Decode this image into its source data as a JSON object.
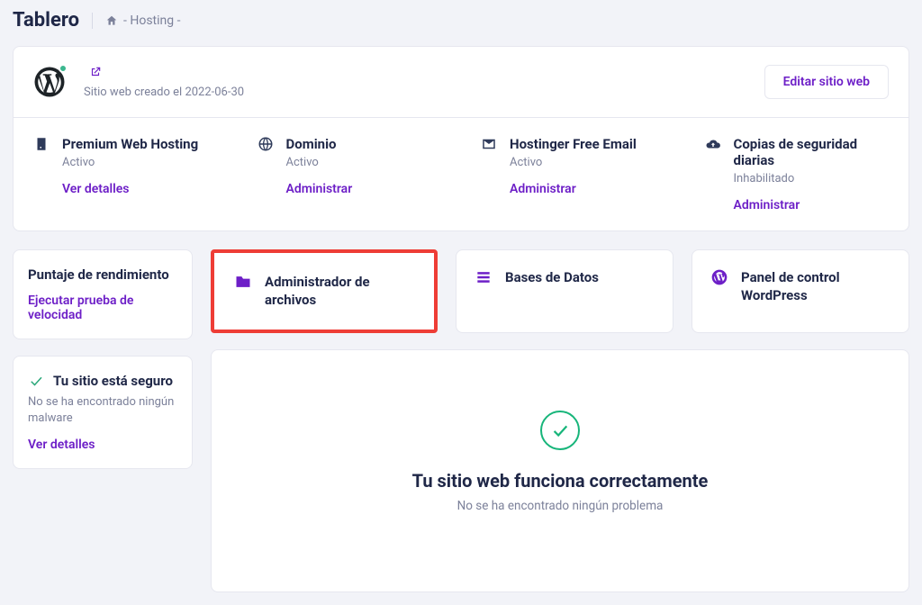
{
  "header": {
    "title": "Tablero",
    "breadcrumb_label": "- Hosting  -"
  },
  "site": {
    "created_prefix": "Sitio web creado el",
    "created_date": "2022-06-30",
    "edit_button": "Editar sitio web"
  },
  "features": [
    {
      "title": "Premium Web Hosting",
      "status": "Activo",
      "link": "Ver detalles"
    },
    {
      "title": "Dominio",
      "status": "Activo",
      "link": "Administrar"
    },
    {
      "title": "Hostinger Free Email",
      "status": "Activo",
      "link": "Administrar"
    },
    {
      "title": "Copias de seguridad diarias",
      "status": "Inhabilitado",
      "link": "Administrar"
    }
  ],
  "left_cards": {
    "performance": {
      "title": "Puntaje de rendimiento",
      "link": "Ejecutar prueba de velocidad"
    },
    "security": {
      "title": "Tu sitio está seguro",
      "text": "No se ha encontrado ningún malware",
      "link": "Ver detalles"
    }
  },
  "tools": [
    {
      "label": "Administrador de archivos",
      "icon": "folder"
    },
    {
      "label": "Bases de Datos",
      "icon": "db"
    },
    {
      "label": "Panel de control WordPress",
      "icon": "wp"
    }
  ],
  "status_panel": {
    "title": "Tu sitio web funciona correctamente",
    "sub": "No se ha encontrado ningún problema"
  }
}
